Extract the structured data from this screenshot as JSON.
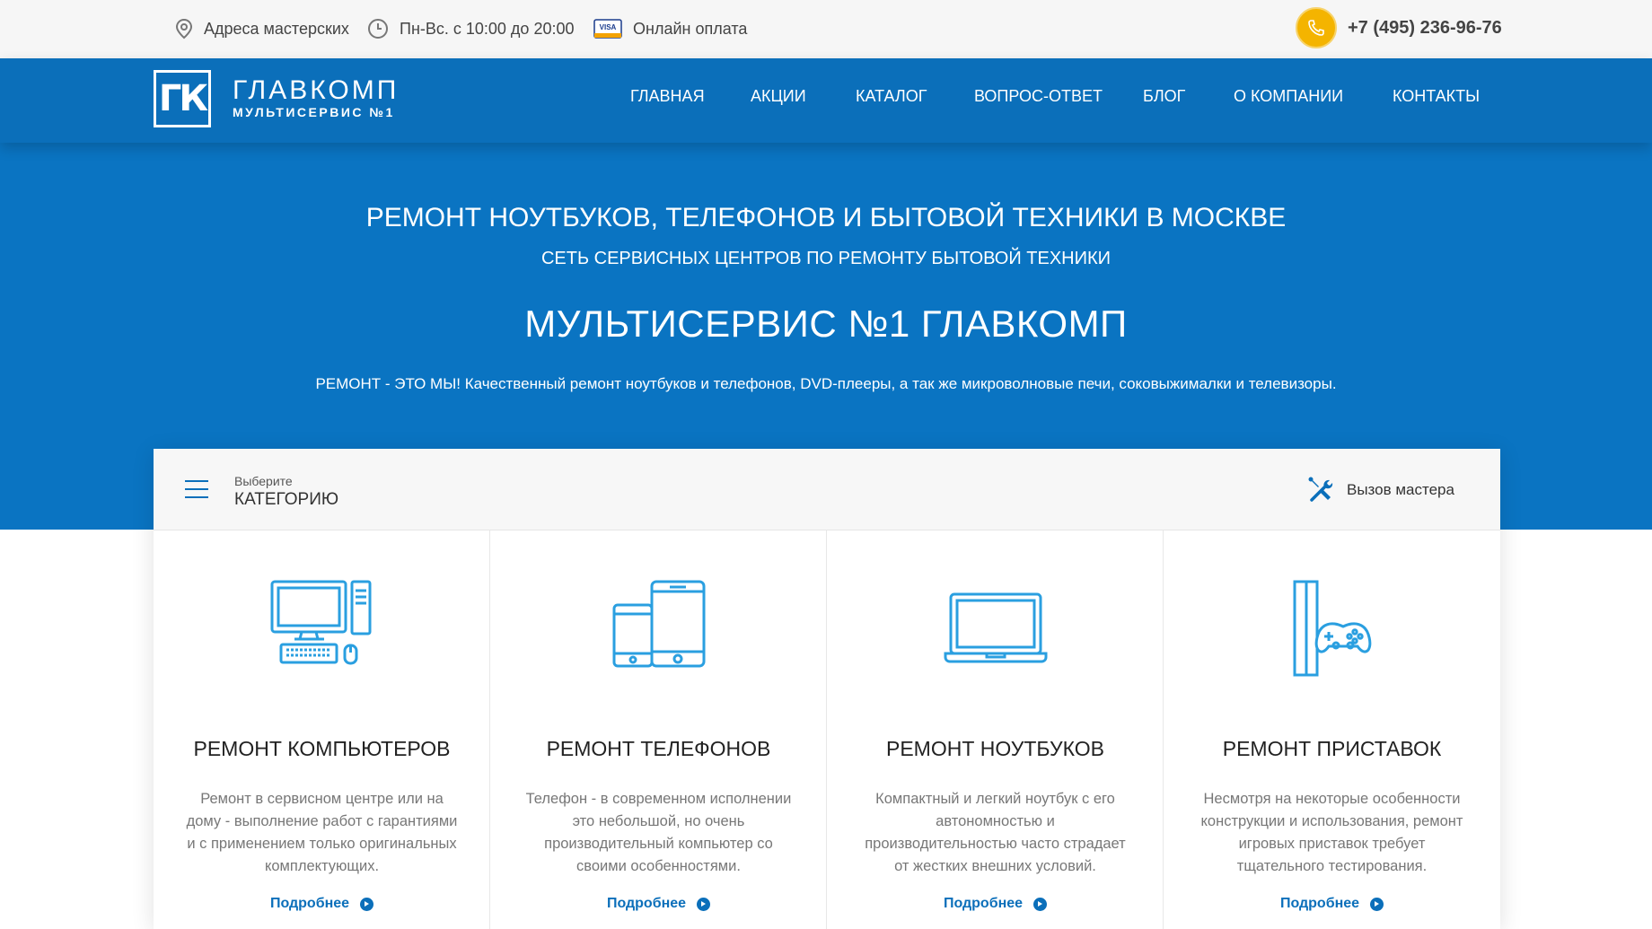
{
  "topbar": {
    "address_label": "Адреса мастерских",
    "hours_label": "Пн-Вс. с 10:00 до 20:00",
    "visa_text": "VISA",
    "payment_label": "Онлайн оплата",
    "phone": "+7 (495) 236-96-76"
  },
  "brand": {
    "logo_letters": "ГК",
    "title": "ГЛАВКОМП",
    "subtitle": "МУЛЬТИСЕРВИС №1"
  },
  "nav": [
    {
      "label": "ГЛАВНАЯ"
    },
    {
      "label": "АКЦИИ"
    },
    {
      "label": "КАТАЛОГ"
    },
    {
      "label": "ВОПРОС-ОТВЕТ"
    },
    {
      "label": "БЛОГ"
    },
    {
      "label": "О КОМПАНИИ"
    },
    {
      "label": "КОНТАКТЫ"
    }
  ],
  "hero": {
    "line1": "РЕМОНТ НОУТБУКОВ, ТЕЛЕФОНОВ И БЫТОВОЙ ТЕХНИКИ В МОСКВЕ",
    "line2": "СЕТЬ СЕРВИСНЫХ ЦЕНТРОВ ПО РЕМОНТУ БЫТОВОЙ ТЕХНИКИ",
    "title": "МУЛЬТИСЕРВИС №1 ГЛАВКОМП",
    "description": "РЕМОНТ - ЭТО МЫ! Качественный ремонт ноутбуков и телефонов, DVD-плееры, а так же микроволновые печи, соковыжималки и телевизоры."
  },
  "category": {
    "small_label": "Выберите",
    "big_label": "КАТЕГОРИЮ",
    "master_label": "Вызов мастера"
  },
  "cards": [
    {
      "icon": "computer-icon",
      "title": "РЕМОНТ КОМПЬЮТЕРОВ",
      "text": "Ремонт в сервисном центре или на дому - выполнение работ с гарантиями и с применением только оригинальных комплектующих.",
      "more": "Подробнее"
    },
    {
      "icon": "phone-tablet-icon",
      "title": "РЕМОНТ ТЕЛЕФОНОВ",
      "text": "Телефон - в современном исполнении это небольшой, но очень производительный компьютер со своими особенностями.",
      "more": "Подробнее"
    },
    {
      "icon": "laptop-icon",
      "title": "РЕМОНТ НОУТБУКОВ",
      "text": "Компактный и легкий ноутбук с его автономностью и производительностью часто страдает от жестких внешних условий.",
      "more": "Подробнее"
    },
    {
      "icon": "console-icon",
      "title": "РЕМОНТ ПРИСТАВОК",
      "text": "Несмотря на некоторые особенности конструкции и использования, ремонт игровых приставок требует тщательного тестирования.",
      "more": "Подробнее"
    }
  ],
  "colors": {
    "primary": "#0b6fba",
    "hero_bg": "#0a74c2",
    "icon_blue": "#2a9fe0",
    "phone_accent": "#f4b400"
  }
}
